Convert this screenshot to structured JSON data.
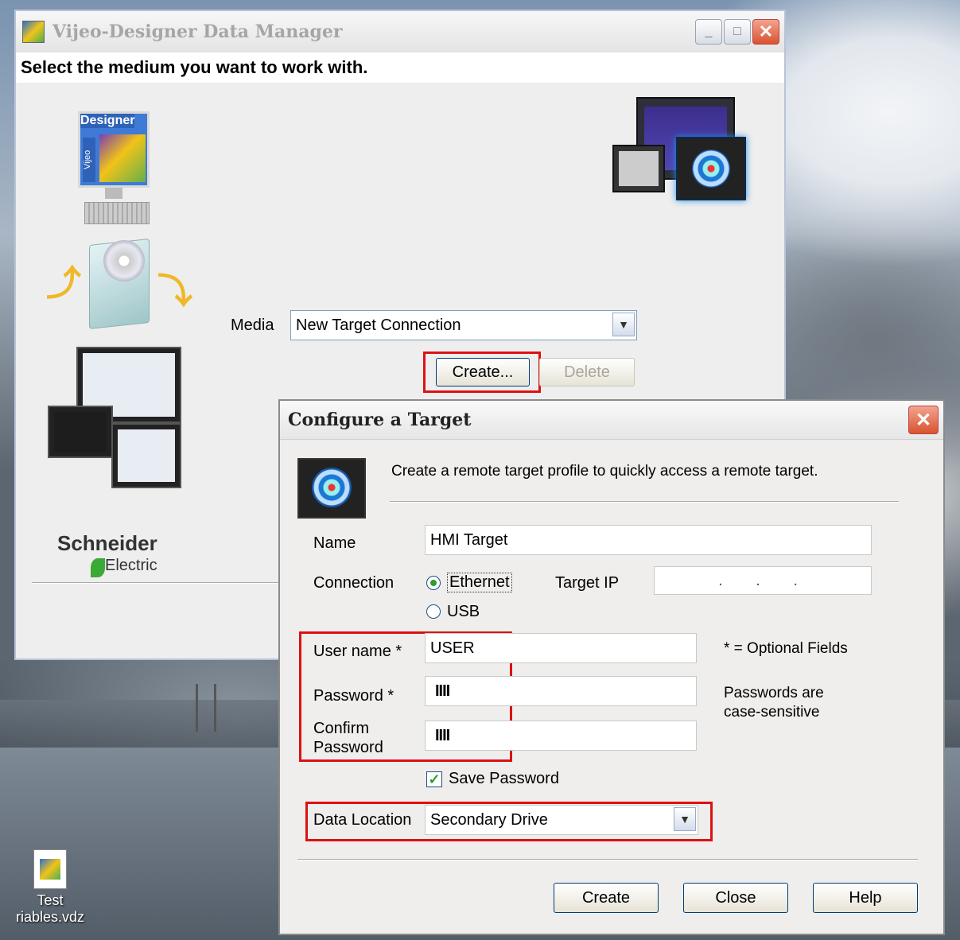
{
  "desktop": {
    "icon_label_1": "Test",
    "icon_label_2": "riables.vdz"
  },
  "main_window": {
    "title": "Vijeo-Designer Data Manager",
    "heading": "Select the medium you want to work with.",
    "designer_logo_text": "Designer",
    "vijeo_logo_text": "Vijeo",
    "brand_name": "Schneider",
    "brand_sub": "Electric",
    "media_label": "Media",
    "media_value": "New Target Connection",
    "create_button": "Create...",
    "delete_button": "Delete",
    "minimize_glyph": "_",
    "maximize_glyph": "□",
    "close_glyph": "✕",
    "dropdown_glyph": "▼"
  },
  "dialog": {
    "title": "Configure a Target",
    "close_glyph": "✕",
    "description": "Create a remote target profile to quickly access a remote target.",
    "name_label": "Name",
    "name_value": "HMI Target",
    "connection_label": "Connection",
    "ethernet_label": "Ethernet",
    "usb_label": "USB",
    "connection_selected": "Ethernet",
    "target_ip_label": "Target IP",
    "target_ip_value": ". . .",
    "username_label": "User name *",
    "username_value": "USER",
    "password_label": "Password *",
    "password_value": "IIII",
    "confirm_label_1": "Confirm",
    "confirm_label_2": "Password",
    "confirm_value": "IIII",
    "optional_note": "* = Optional Fields",
    "case_note_1": "Passwords are",
    "case_note_2": "case-sensitive",
    "save_password_label": "Save Password",
    "save_password_checked": true,
    "check_glyph": "✓",
    "data_location_label": "Data Location",
    "data_location_value": "Secondary Drive",
    "dropdown_glyph": "▼",
    "buttons": {
      "create": "Create",
      "close": "Close",
      "help": "Help"
    }
  },
  "colors": {
    "highlight": "#dd1111",
    "window_bg": "#eeeeee",
    "title_text_inactive": "#a6a6a6"
  }
}
